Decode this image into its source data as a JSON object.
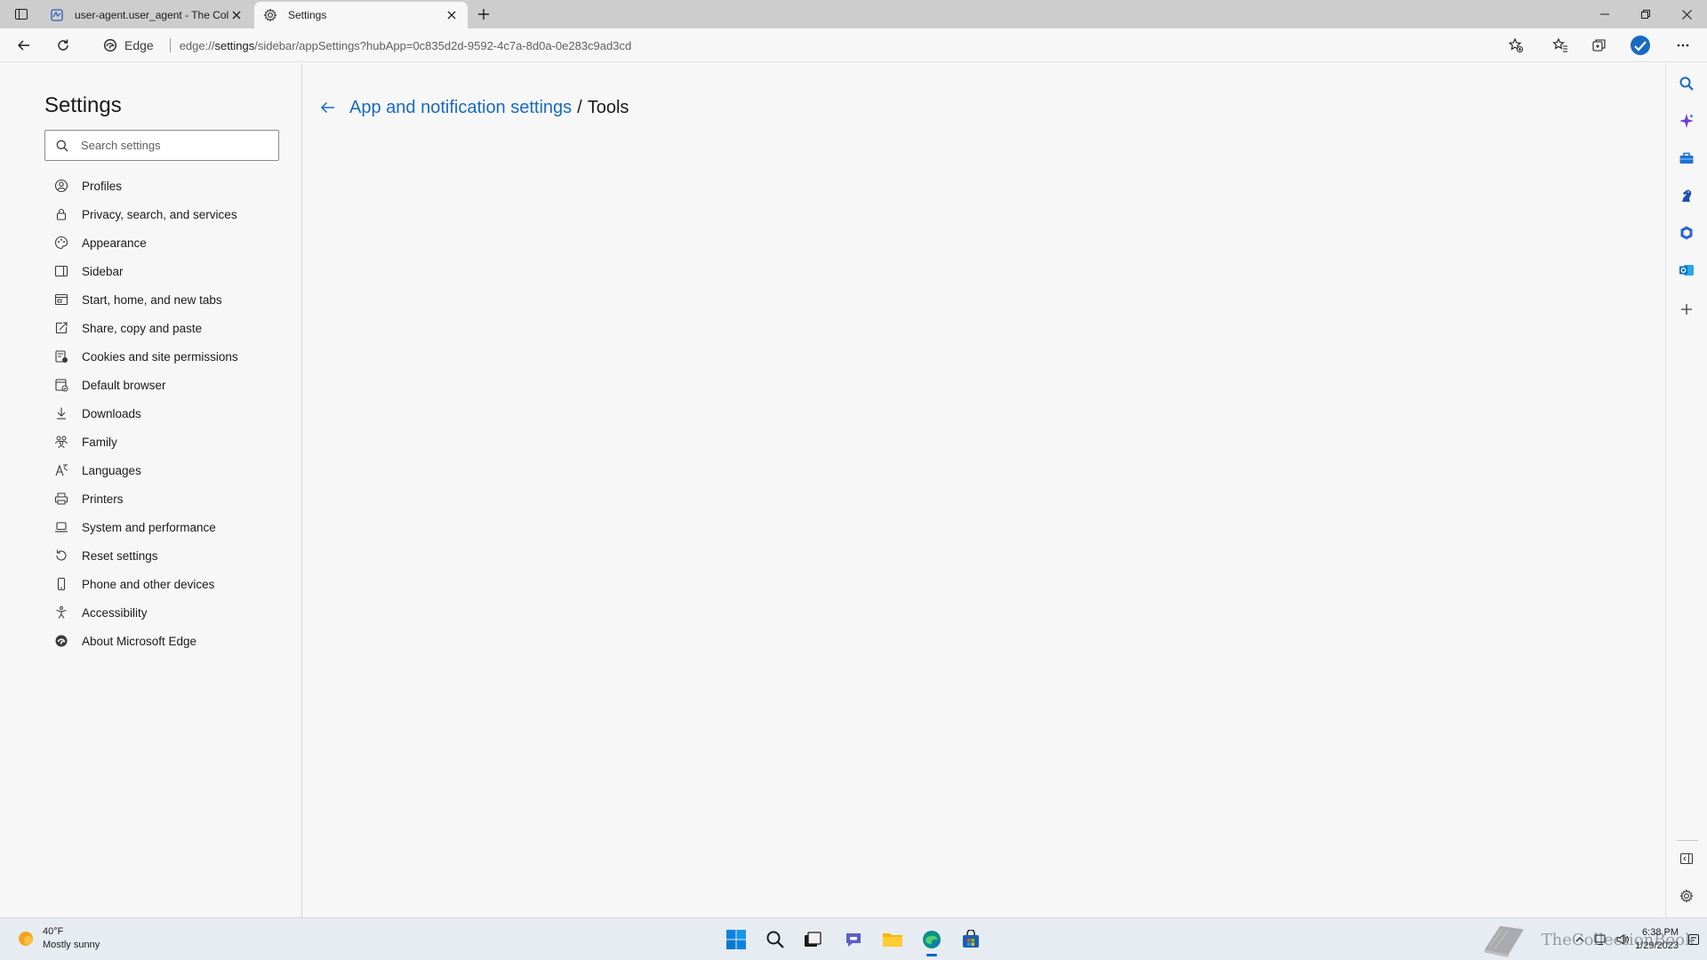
{
  "browser": {
    "tabs": [
      {
        "title": "user-agent.user_agent - The Coll",
        "active": false,
        "icon": "document-favicon-icon"
      },
      {
        "title": "Settings",
        "active": true,
        "icon": "gear-icon"
      }
    ],
    "address": {
      "chip_label": "Edge",
      "url_prefix": "edge://",
      "url_host": "settings",
      "url_path": "/sidebar/appSettings?hubApp=0c835d2d-9592-4c7a-8d0a-0e283c9ad3cd"
    }
  },
  "settings_nav": {
    "title": "Settings",
    "search_placeholder": "Search settings",
    "items": [
      {
        "label": "Profiles",
        "icon": "profile-icon"
      },
      {
        "label": "Privacy, search, and services",
        "icon": "lock-icon"
      },
      {
        "label": "Appearance",
        "icon": "palette-icon"
      },
      {
        "label": "Sidebar",
        "icon": "sidebar-icon"
      },
      {
        "label": "Start, home, and new tabs",
        "icon": "home-icon"
      },
      {
        "label": "Share, copy and paste",
        "icon": "share-icon"
      },
      {
        "label": "Cookies and site permissions",
        "icon": "cookies-icon"
      },
      {
        "label": "Default browser",
        "icon": "browser-icon"
      },
      {
        "label": "Downloads",
        "icon": "download-icon"
      },
      {
        "label": "Family",
        "icon": "family-icon"
      },
      {
        "label": "Languages",
        "icon": "languages-icon"
      },
      {
        "label": "Printers",
        "icon": "printer-icon"
      },
      {
        "label": "System and performance",
        "icon": "laptop-icon"
      },
      {
        "label": "Reset settings",
        "icon": "reset-icon"
      },
      {
        "label": "Phone and other devices",
        "icon": "phone-icon"
      },
      {
        "label": "Accessibility",
        "icon": "accessibility-icon"
      },
      {
        "label": "About Microsoft Edge",
        "icon": "edge-logo-icon"
      }
    ]
  },
  "main": {
    "breadcrumb_parent": "App and notification settings",
    "breadcrumb_separator": "/",
    "breadcrumb_current": "Tools"
  },
  "taskbar": {
    "weather_temp": "40°F",
    "weather_desc": "Mostly sunny",
    "time": "6:38 PM",
    "date": "1/29/2023",
    "watermark_text": "TheCollectionBook"
  },
  "colors": {
    "accent": "#1a6ac2",
    "tabstrip": "#cdcdcd",
    "background": "#f7f7f7"
  }
}
